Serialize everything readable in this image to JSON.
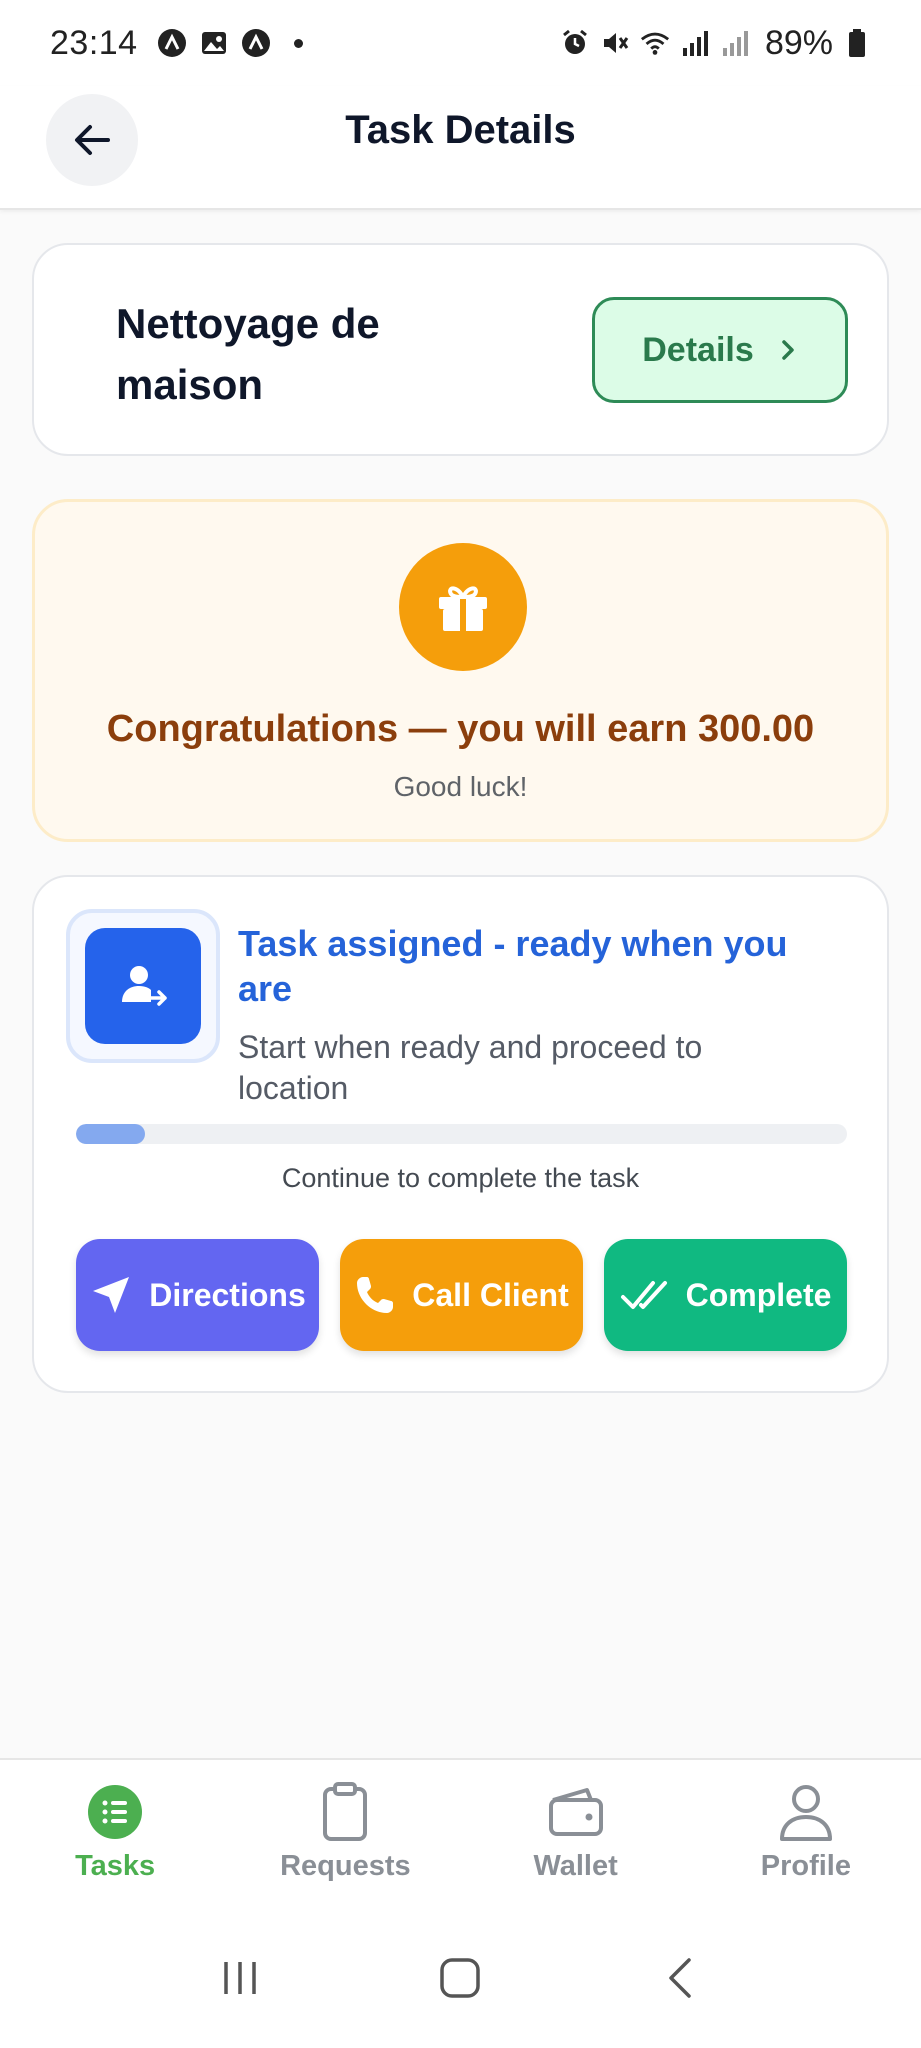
{
  "status_bar": {
    "time": "23:14",
    "battery": "89%",
    "icons_left": [
      "app-a-icon",
      "image-icon",
      "app-a-icon",
      "dot-icon"
    ],
    "icons_right": [
      "alarm-icon",
      "mute-icon",
      "wifi-icon",
      "signal-icon",
      "signal-weak-icon",
      "battery-icon"
    ]
  },
  "header": {
    "title": "Task Details",
    "back_icon": "arrow-left-icon"
  },
  "task": {
    "name": "Nettoyage de maison",
    "details_label": "Details"
  },
  "reward": {
    "title": "Congratulations — you will earn 300.00",
    "subtitle": "Good luck!"
  },
  "status": {
    "title": "Task assigned - ready when you are",
    "description": "Start when ready and proceed to location",
    "progress_fraction": 0.09,
    "caption": "Continue to complete the task"
  },
  "actions": {
    "directions": "Directions",
    "call_client": "Call Client",
    "complete": "Complete"
  },
  "bottom_nav": {
    "items": [
      {
        "label": "Tasks",
        "icon": "list-icon",
        "active": true
      },
      {
        "label": "Requests",
        "icon": "clipboard-icon",
        "active": false
      },
      {
        "label": "Wallet",
        "icon": "wallet-icon",
        "active": false
      },
      {
        "label": "Profile",
        "icon": "user-icon",
        "active": false
      }
    ]
  },
  "colors": {
    "accent_green": "#4caf50",
    "blue": "#2563eb",
    "orange": "#f59e0b",
    "indigo": "#6366f1",
    "emerald": "#10b981"
  }
}
